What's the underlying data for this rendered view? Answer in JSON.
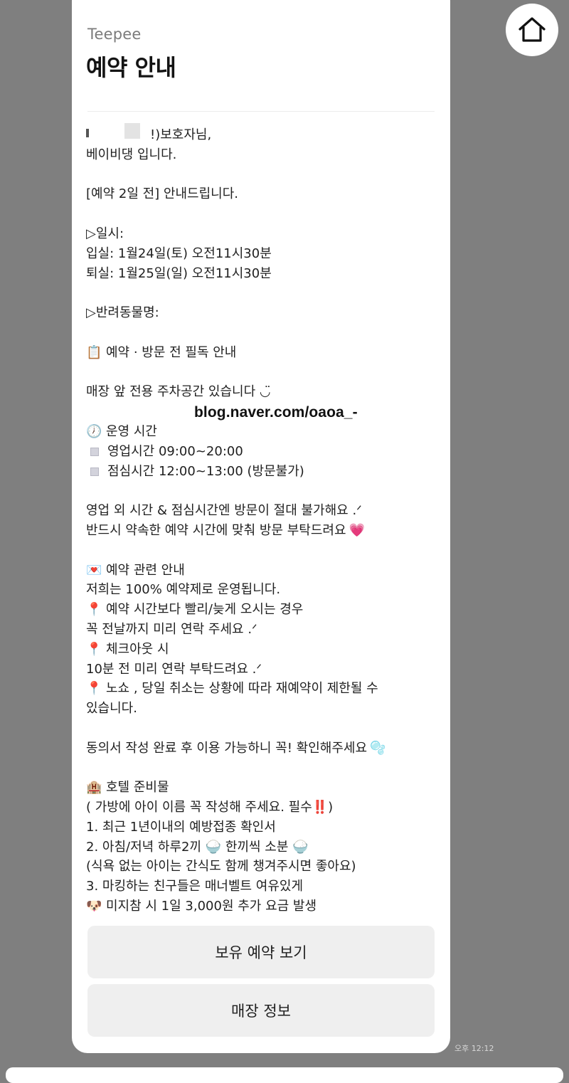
{
  "header": {
    "brand": "Teepee",
    "title": "예약 안내"
  },
  "message": {
    "greeting": "!)보호자님,",
    "lines": [
      {
        "text": "베이비댕 입니다.",
        "emoji": ""
      },
      {
        "text": "",
        "emoji": ""
      },
      {
        "text": "[예약 2일 전] 안내드립니다.",
        "emoji": ""
      },
      {
        "text": "",
        "emoji": ""
      },
      {
        "text": "▷일시:",
        "emoji": ""
      },
      {
        "text": "입실: 1월24일(토) 오전11시30분",
        "emoji": ""
      },
      {
        "text": "퇴실: 1월25일(일) 오전11시30분",
        "emoji": ""
      },
      {
        "text": "",
        "emoji": ""
      },
      {
        "text": "▷반려동물명:",
        "emoji": ""
      },
      {
        "text": "",
        "emoji": ""
      },
      {
        "text": "예약 · 방문 전 필독 안내",
        "emoji": "📋"
      },
      {
        "text": "",
        "emoji": ""
      },
      {
        "text": "매장 앞 전용 주차공간 있습니다 ◡̈",
        "emoji": ""
      },
      {
        "text": "",
        "emoji": ""
      },
      {
        "text": "운영 시간",
        "emoji": "🕖"
      },
      {
        "text": "영업시간 09:00~20:00",
        "emoji": "▫️"
      },
      {
        "text": "점심시간 12:00~13:00 (방문불가)",
        "emoji": "▫️"
      },
      {
        "text": "",
        "emoji": ""
      },
      {
        "text": "영업 외 시간 & 점심시간엔 방문이 절대 불가해요 .ᐟ",
        "emoji": ""
      },
      {
        "text": "반드시 약속한 예약 시간에 맞춰 방문 부탁드려요",
        "emoji": "💗",
        "emoji_after": true
      },
      {
        "text": "",
        "emoji": ""
      },
      {
        "text": "예약 관련 안내",
        "emoji": "💌"
      },
      {
        "text": "저희는 100% 예약제로 운영됩니다.",
        "emoji": ""
      },
      {
        "text": "예약 시간보다 빨리/늦게 오시는 경우",
        "emoji": "📍"
      },
      {
        "text": "꼭 전날까지 미리 연락 주세요 .ᐟ",
        "emoji": ""
      },
      {
        "text": "체크아웃 시",
        "emoji": "📍"
      },
      {
        "text": "10분 전 미리 연락 부탁드려요 .ᐟ",
        "emoji": ""
      },
      {
        "text": "노쇼 , 당일 취소는 상황에 따라 재예약이 제한될 수",
        "emoji": "📍"
      },
      {
        "text": "있습니다.",
        "emoji": ""
      },
      {
        "text": "",
        "emoji": ""
      },
      {
        "text": "동의서 작성 완료 후 이용 가능하니 꼭! 확인해주세요",
        "emoji": "🫧",
        "emoji_after": true
      },
      {
        "text": "",
        "emoji": ""
      },
      {
        "text": "호텔 준비물",
        "emoji": "🏨"
      },
      {
        "text": "( 가방에 아이 이름 꼭 작성해 주세요. 필수‼️)",
        "emoji": ""
      },
      {
        "text": "1. 최근 1년이내의 예방접종 확인서",
        "emoji": ""
      },
      {
        "text": "2. 아침/저녁 하루2끼 🍚 한끼씩 소분 🍚",
        "emoji": ""
      },
      {
        "text": "(식욕 없는 아이는 간식도 함께 챙겨주시면 좋아요)",
        "emoji": ""
      },
      {
        "text": "3. 마킹하는 친구들은 매너벨트 여유있게",
        "emoji": ""
      },
      {
        "text": "미지참 시 1일 3,000원 추가 요금 발생",
        "emoji": "🐶"
      }
    ],
    "watermark": "blog.naver.com/oaoa_-"
  },
  "buttons": {
    "view_reservations": "보유 예약 보기",
    "store_info": "매장 정보"
  },
  "timestamp": "오후 12:12",
  "icons": {
    "home": "home-icon"
  }
}
